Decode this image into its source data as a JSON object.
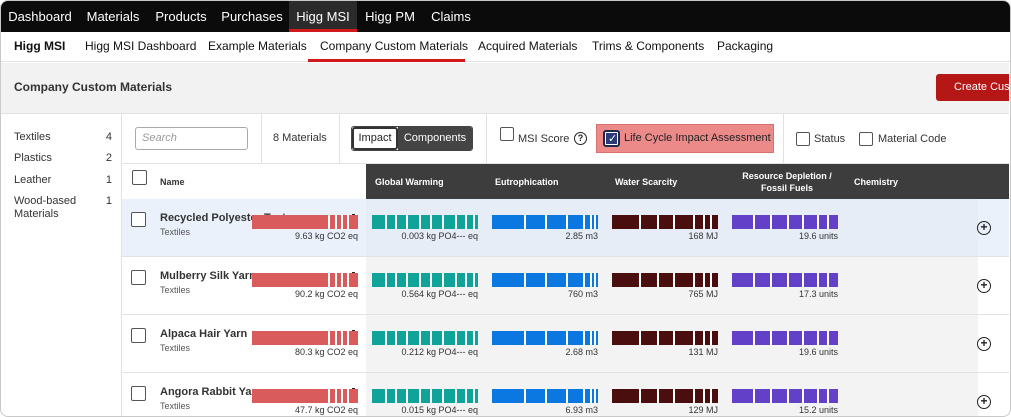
{
  "top_nav": [
    "Dashboard",
    "Materials",
    "Products",
    "Purchases",
    "Higg MSI",
    "Higg PM",
    "Claims"
  ],
  "top_nav_active": "Higg MSI",
  "sub_nav": [
    "Higg MSI",
    "Higg MSI Dashboard",
    "Example Materials",
    "Company Custom Materials",
    "Acquired Materials",
    "Trims & Components",
    "Packaging"
  ],
  "sub_nav_active": "Company Custom Materials",
  "page": {
    "title": "Company Custom Materials",
    "create_button": "Create Custom Material"
  },
  "categories": [
    {
      "label": "Textiles",
      "count": "4"
    },
    {
      "label": "Plastics",
      "count": "2"
    },
    {
      "label": "Leather",
      "count": "1"
    },
    {
      "label": "Wood-based Materials",
      "count": "1"
    }
  ],
  "filters": {
    "search_placeholder": "Search",
    "materials_count": "8 Materials",
    "toggle_left": "Impact",
    "toggle_right": "Components",
    "msi_score": "MSI Score",
    "help_icon": "?",
    "lca": "Life Cycle Impact Assessment",
    "status": "Status",
    "material_code": "Material Code"
  },
  "columns": {
    "name": "Name",
    "impacts": [
      "Global Warming",
      "Eutrophication",
      "Water Scarcity",
      "Resource Depletion / Fossil Fuels",
      "Chemistry"
    ]
  },
  "impact_colors": [
    "#d95b5b",
    "#0fa39a",
    "#0a78e0",
    "#4a0e0e",
    "#6240c8"
  ],
  "rows": [
    {
      "name": "Recycled Polyester Test",
      "category": "Textiles",
      "selected": true,
      "values": [
        "9.63 kg CO2 eq",
        "0.003 kg PO4--- eq",
        "2.85 m3",
        "168 MJ",
        "19.6 units"
      ]
    },
    {
      "name": "Mulberry Silk Yarn",
      "category": "Textiles",
      "selected": false,
      "values": [
        "90.2 kg CO2 eq",
        "0.564 kg PO4--- eq",
        "760 m3",
        "765 MJ",
        "17.3 units"
      ]
    },
    {
      "name": "Alpaca Hair Yarn",
      "category": "Textiles",
      "selected": false,
      "values": [
        "80.3 kg CO2 eq",
        "0.212 kg PO4--- eq",
        "2.68 m3",
        "131 MJ",
        "19.6 units"
      ]
    },
    {
      "name": "Angora Rabbit Yarn",
      "category": "Textiles",
      "selected": false,
      "values": [
        "47.7 kg CO2 eq",
        "0.015 kg PO4--- eq",
        "6.93 m3",
        "129 MJ",
        "15.2 units"
      ]
    }
  ]
}
